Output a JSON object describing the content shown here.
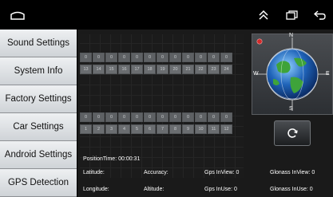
{
  "status_bar": {
    "icons": [
      "home-icon",
      "double-chevron-up-icon",
      "recents-icon",
      "back-icon"
    ]
  },
  "sidebar": {
    "items": [
      {
        "label": "Sound Settings"
      },
      {
        "label": "System Info"
      },
      {
        "label": "Factory Settings"
      },
      {
        "label": "Car Settings"
      },
      {
        "label": "Android Settings"
      },
      {
        "label": "GPS Detection"
      }
    ]
  },
  "gps": {
    "group_a": {
      "values": [
        "0",
        "0",
        "0",
        "0",
        "0",
        "0",
        "0",
        "0",
        "0",
        "0",
        "0",
        "0"
      ],
      "ids": [
        "13",
        "14",
        "15",
        "16",
        "17",
        "18",
        "19",
        "20",
        "21",
        "22",
        "23",
        "24"
      ]
    },
    "group_b": {
      "values": [
        "0",
        "0",
        "0",
        "0",
        "0",
        "0",
        "0",
        "0",
        "0",
        "0",
        "0",
        "0"
      ],
      "ids": [
        "1",
        "2",
        "3",
        "4",
        "5",
        "6",
        "7",
        "8",
        "9",
        "10",
        "11",
        "12"
      ]
    },
    "compass": {
      "n": "N",
      "s": "S",
      "e": "E",
      "w": "W"
    },
    "position_time": "PositionTime: 00:00:31",
    "latitude_label": "Latitude:",
    "longitude_label": "Longitude:",
    "accuracy_label": "Accuracy:",
    "altitude_label": "Altitude:",
    "gps_in_view": "Gps InView: 0",
    "gps_in_use": "Gps InUse: 0",
    "glonass_in_view": "Glonass InView: 0",
    "glonass_in_use": "Glonass InUse: 0"
  },
  "colors": {
    "accent_red": "#d32a2a",
    "globe_blue": "#1f63b8",
    "land_green": "#3ea33a"
  }
}
